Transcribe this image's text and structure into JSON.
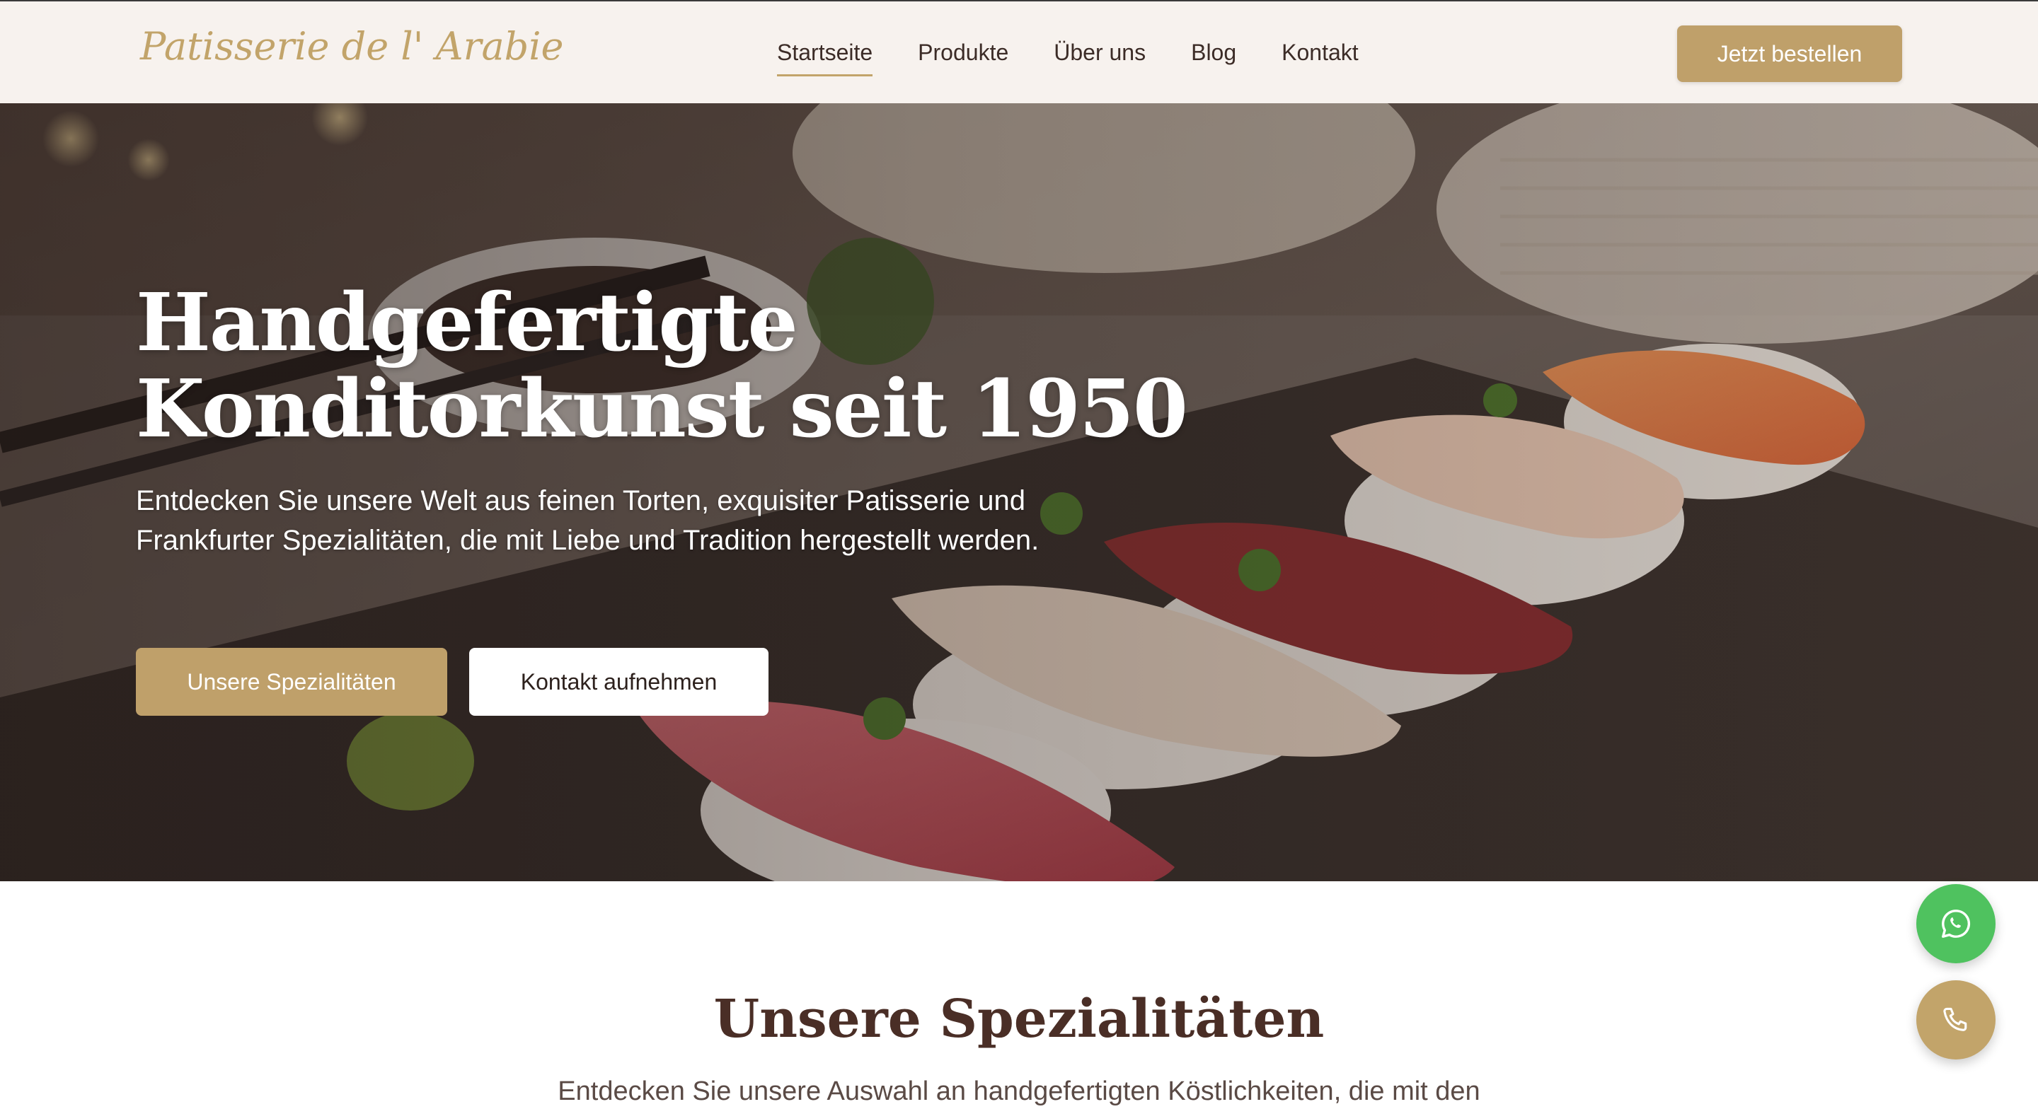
{
  "header": {
    "logo_text": "Patisserie de l' Arabie",
    "nav": [
      {
        "label": "Startseite",
        "active": true
      },
      {
        "label": "Produkte",
        "active": false
      },
      {
        "label": "Über uns",
        "active": false
      },
      {
        "label": "Blog",
        "active": false
      },
      {
        "label": "Kontakt",
        "active": false
      }
    ],
    "order_button": "Jetzt bestellen"
  },
  "hero": {
    "title_line1": "Handgefertigte",
    "title_line2": "Konditorkunst seit 1950",
    "subtitle": "Entdecken Sie unsere Welt aus feinen Torten, exquisiter Patisserie und Frankfurter Spezialitäten, die mit Liebe und Tradition hergestellt werden.",
    "primary_button": "Unsere Spezialitäten",
    "secondary_button": "Kontakt aufnehmen"
  },
  "specialties": {
    "title": "Unsere Spezialitäten",
    "subtitle": "Entdecken Sie unsere Auswahl an handgefertigten Köstlichkeiten, die mit den"
  },
  "floating": {
    "whatsapp_icon": "whatsapp-icon",
    "phone_icon": "phone-icon"
  },
  "colors": {
    "accent": "#bfa06a",
    "header_bg": "#f7f2ee",
    "heading": "#4a2e26",
    "whatsapp": "#4fc25f"
  }
}
